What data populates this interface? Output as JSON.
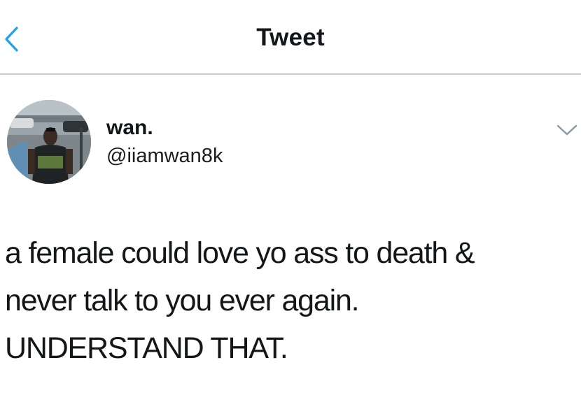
{
  "header": {
    "title": "Tweet",
    "back_icon": "chevron-left-icon",
    "accent_color": "#1da1f2"
  },
  "author": {
    "display_name": "wan.",
    "handle": "@iiamwan8k",
    "avatar_icon": "profile-photo",
    "menu_icon": "chevron-down-icon"
  },
  "tweet": {
    "lines": [
      "a female could love yo ass to death &",
      "never talk to you ever again.",
      "UNDERSTAND THAT."
    ]
  }
}
